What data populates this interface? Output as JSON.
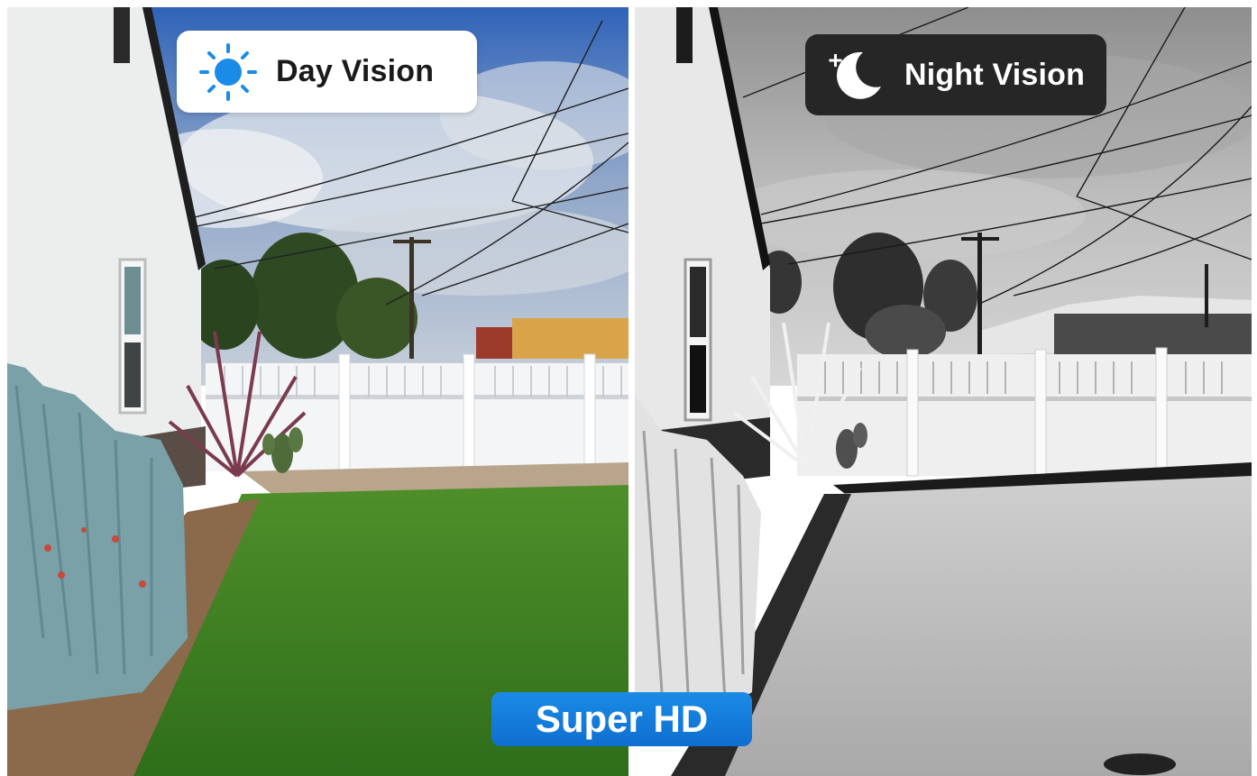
{
  "comparison": {
    "day": {
      "label": "Day Vision",
      "icon": "sun-icon",
      "icon_color": "#1a8be6"
    },
    "night": {
      "label": "Night Vision",
      "icon": "moon-stars-icon",
      "icon_color": "#ffffff",
      "badge_color": "#262626"
    },
    "feature": {
      "label": "Super HD",
      "badge_color": "#1478da"
    }
  }
}
